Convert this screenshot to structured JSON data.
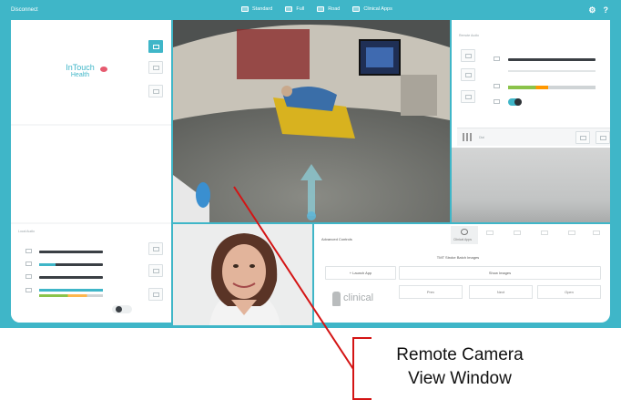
{
  "topbar": {
    "disconnect_label": "Disconnect",
    "nav": [
      {
        "label": "Standard",
        "icon": "monitor-icon"
      },
      {
        "label": "Full",
        "icon": "fullscreen-icon"
      },
      {
        "label": "Road",
        "icon": "road-icon"
      },
      {
        "label": "Clinical Apps",
        "icon": "apps-icon"
      }
    ],
    "settings_icon": "gear-icon",
    "help_label": "?"
  },
  "left_panel": {
    "logo_line1": "InTouch",
    "logo_line2": "Health",
    "brand_color": "#3fb6c8",
    "audio_section_label": "Local Audio"
  },
  "right_panel": {
    "section_label": "Remote Audio",
    "keypad_label": "Dial",
    "status_green": "#8bc34a",
    "status_orange": "#ff9800"
  },
  "clinical": {
    "panel_title": "Advanced Controls",
    "app_tab_label": "Clinical Apps",
    "header_text": "TMT Stroke Batch Images",
    "launch_app_label": "+ Launch App",
    "show_images_label": "Show Images",
    "logo_text": "clinical",
    "prev_label": "Prev",
    "next_label": "Next",
    "open_label": "Open"
  },
  "callout": {
    "line1": "Remote Camera",
    "line2": "View Window",
    "line_color": "#d41414"
  }
}
